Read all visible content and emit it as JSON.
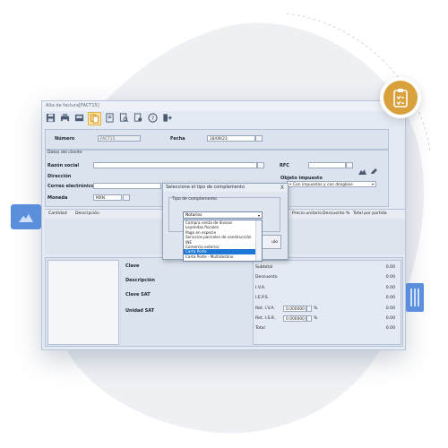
{
  "window": {
    "title": "Alta de factura[FACT15]"
  },
  "toolbar": {
    "icons": [
      "save-icon",
      "print-icon",
      "printer-icon",
      "copy-doc-icon",
      "document-icon",
      "search-doc-icon",
      "settings-doc-icon",
      "help-icon",
      "exit-icon"
    ]
  },
  "header": {
    "numero_label": "Número",
    "numero_value": "FACT15",
    "fecha_label": "Fecha",
    "fecha_value": "18/09/23"
  },
  "client": {
    "section_label": "Datos del cliente",
    "razon_social_label": "Razón social",
    "direccion_label": "Dirección",
    "correo_label": "Correo electrónico",
    "moneda_label": "Moneda",
    "moneda_value": "MXN",
    "rfc_label": "RFC",
    "objeto_label": "Objeto impuesto",
    "objeto_value": "• Con impuestos y con desglose"
  },
  "items_table": {
    "headers": [
      "Cantidad",
      "Descripción",
      "Precio unitario",
      "Descuento %",
      "Total por partida"
    ]
  },
  "details": {
    "clave_label": "Clave",
    "descripcion_label": "Descripción",
    "clave_sat_label": "Clave SAT",
    "unidad_sat_label": "Unidad SAT"
  },
  "totals": {
    "subtotal_label": "Subtotal",
    "subtotal_value": "0.00",
    "descuento_label": "Descuento",
    "descuento_value": "0.00",
    "iva_label": "I.V.A.",
    "iva_value": "0.00",
    "ieps_label": "I.E.P.S.",
    "ieps_value": "0.00",
    "ret_iva_label": "Ret. I.V.A.",
    "ret_iva_rate": "0.000000",
    "ret_iva_value": "0.00",
    "ret_isr_label": "Ret. I.S.R.",
    "ret_isr_rate": "0.000000",
    "ret_isr_value": "0.00",
    "total_label": "Total",
    "total_value": "0.00",
    "percent_sign": "%"
  },
  "dialog": {
    "title": "Seleccione el tipo de complemento",
    "close": "X",
    "group_label": "Tipo de complemento",
    "selected": "Notarios",
    "options": [
      "Compra venta de divisas",
      "Leyendas fiscales",
      "Pago en especie",
      "Servicios parciales de construcción",
      "INE",
      "Comercio exterior",
      "Carta Porte",
      "Carta Porte - Multidestino"
    ],
    "highlighted_index": 6,
    "button_partial": "ulo"
  },
  "colors": {
    "accent": "#d9a13b",
    "side_tab": "#5b8fdc",
    "list_highlight": "#1c78d4"
  }
}
